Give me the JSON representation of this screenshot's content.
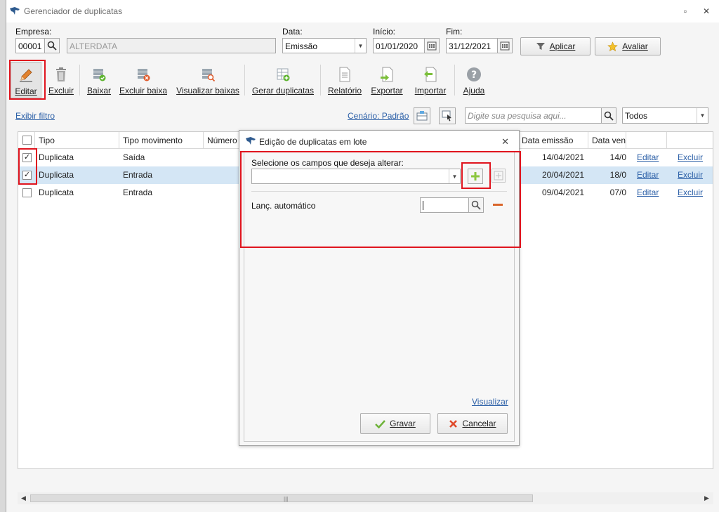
{
  "window": {
    "title": "Gerenciador de duplicatas"
  },
  "filters": {
    "empresa_label": "Empresa:",
    "empresa_code": "00001",
    "empresa_name": "ALTERDATA",
    "data_label": "Data:",
    "data_value": "Emissão",
    "inicio_label": "Início:",
    "inicio_value": "01/01/2020",
    "fim_label": "Fim:",
    "fim_value": "31/12/2021",
    "aplicar_label": "Aplicar",
    "avaliar_label": "Avaliar"
  },
  "toolbar": {
    "editar": "Editar",
    "excluir": "Excluir",
    "baixar": "Baixar",
    "excluir_baixa": "Excluir baixa",
    "visualizar_baixas": "Visualizar baixas",
    "gerar_duplicatas": "Gerar duplicatas",
    "relatorio": "Relatório",
    "exportar": "Exportar",
    "importar": "Importar",
    "ajuda": "Ajuda"
  },
  "filterbar": {
    "exibir_filtro": "Exibir filtro",
    "cenario": "Cenário: Padrão",
    "search_placeholder": "Digite sua pesquisa aqui...",
    "scope_value": "Todos"
  },
  "grid": {
    "headers": [
      "Tipo",
      "Tipo movimento",
      "Número",
      "Data emissão",
      "Data venc"
    ],
    "rows": [
      {
        "checked": true,
        "tipo": "Duplicata",
        "movimento": "Saída",
        "emissao": "14/04/2021",
        "venc": "14/0",
        "editar": "Editar",
        "excluir": "Excluir"
      },
      {
        "checked": true,
        "tipo": "Duplicata",
        "movimento": "Entrada",
        "emissao": "20/04/2021",
        "venc": "18/0",
        "editar": "Editar",
        "excluir": "Excluir"
      },
      {
        "checked": false,
        "tipo": "Duplicata",
        "movimento": "Entrada",
        "emissao": "09/04/2021",
        "venc": "07/0",
        "editar": "Editar",
        "excluir": "Excluir"
      }
    ]
  },
  "dialog": {
    "title": "Edição de duplicatas em lote",
    "select_label": "Selecione os campos que deseja alterar:",
    "field_label": "Lanç. automático",
    "visualizar": "Visualizar",
    "gravar": "Gravar",
    "cancelar": "Cancelar"
  },
  "colors": {
    "accent": "#2b5fa7",
    "highlight": "#e0141e",
    "selected_row": "#d4e6f5"
  }
}
